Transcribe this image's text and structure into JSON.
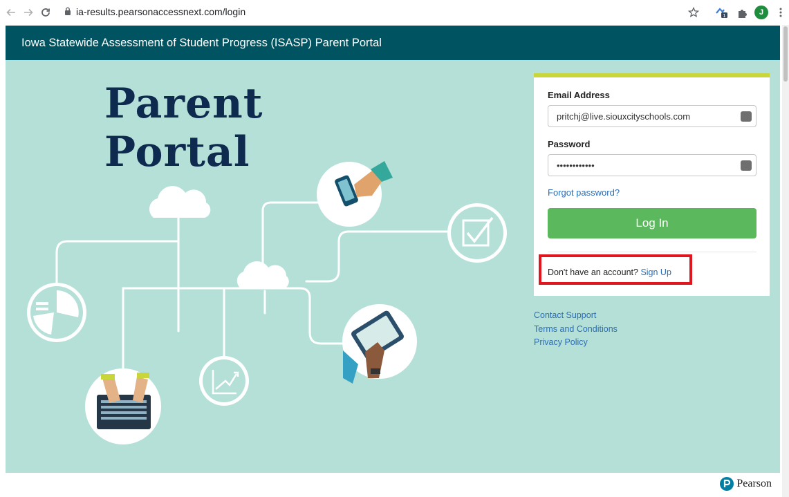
{
  "browser": {
    "url": "ia-results.pearsonaccessnext.com/login",
    "profile_initial": "J"
  },
  "header": {
    "title": "Iowa Statewide Assessment of Student Progress (ISASP) Parent Portal"
  },
  "hero": {
    "title_line1": "Parent",
    "title_line2": "Portal"
  },
  "login": {
    "email_label": "Email Address",
    "email_value": "pritchj@live.siouxcityschools.com",
    "password_label": "Password",
    "password_value": "••••••••••••",
    "forgot_label": "Forgot password?",
    "login_label": "Log In",
    "signup_prompt": "Don't have an account?",
    "signup_link": "Sign Up"
  },
  "footer": {
    "links": [
      "Contact Support",
      "Terms and Conditions",
      "Privacy Policy"
    ]
  },
  "brand": {
    "name": "Pearson"
  },
  "colors": {
    "header_bg": "#005461",
    "hero_bg": "#b5e0d8",
    "title_color": "#0f2a4f",
    "accent_bar": "#c8d63a",
    "login_button": "#5cb85c",
    "link": "#2a6db5",
    "highlight": "#e1151d"
  }
}
